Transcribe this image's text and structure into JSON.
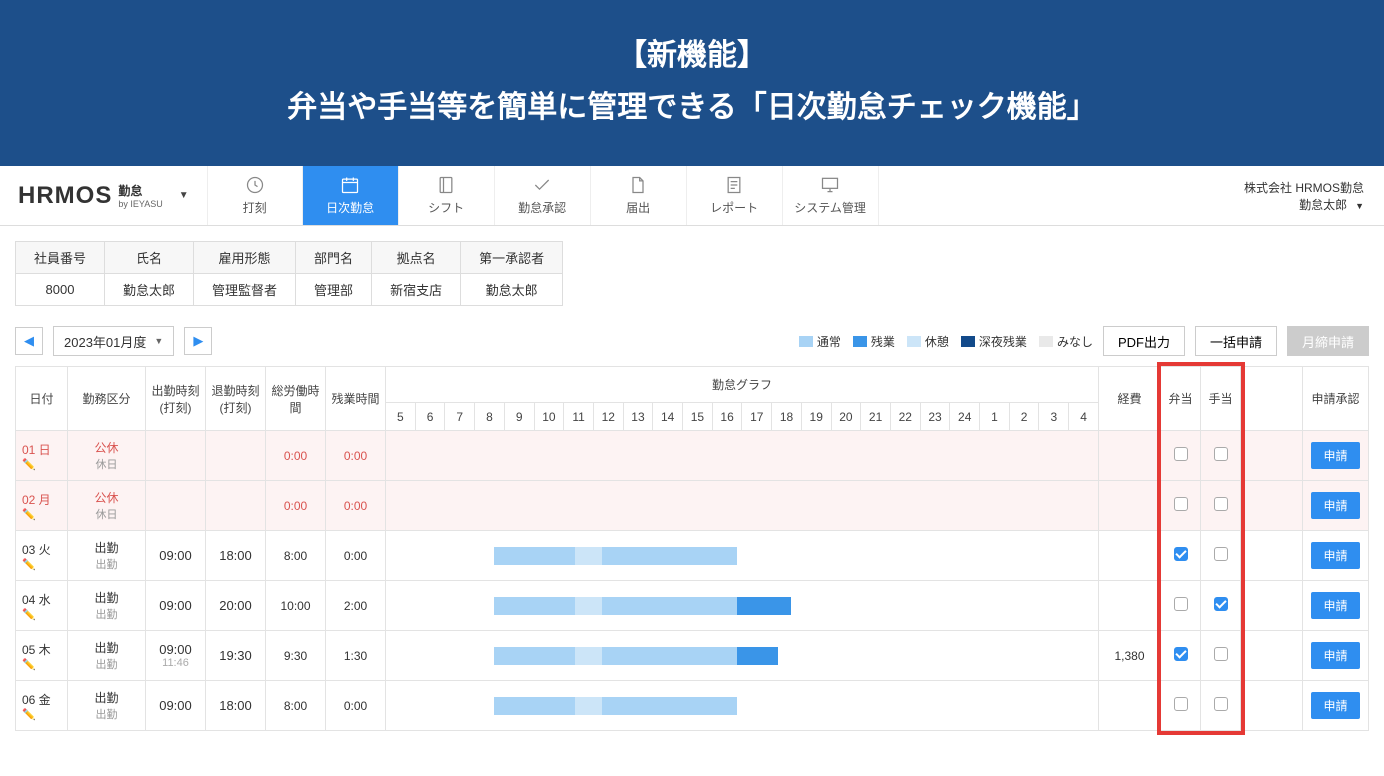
{
  "banner": {
    "line1": "【新機能】",
    "line2": "弁当や手当等を簡単に管理できる「日次勤怠チェック機能」"
  },
  "logo": {
    "main": "HRMOS",
    "sub": "勤怠",
    "tiny": "by IEYASU"
  },
  "nav": [
    {
      "label": "打刻",
      "icon": "clock"
    },
    {
      "label": "日次勤怠",
      "icon": "calendar",
      "active": true
    },
    {
      "label": "シフト",
      "icon": "notebook"
    },
    {
      "label": "勤怠承認",
      "icon": "check"
    },
    {
      "label": "届出",
      "icon": "file"
    },
    {
      "label": "レポート",
      "icon": "doc"
    },
    {
      "label": "システム管理",
      "icon": "monitor"
    }
  ],
  "user": {
    "company": "株式会社 HRMOS勤怠",
    "name": "勤怠太郎"
  },
  "emp": {
    "headers": [
      "社員番号",
      "氏名",
      "雇用形態",
      "部門名",
      "拠点名",
      "第一承認者"
    ],
    "values": [
      "8000",
      "勤怠太郎",
      "管理監督者",
      "管理部",
      "新宿支店",
      "勤怠太郎"
    ]
  },
  "period": "2023年01月度",
  "legend": [
    {
      "label": "通常",
      "cls": "sw-a"
    },
    {
      "label": "残業",
      "cls": "sw-b"
    },
    {
      "label": "休憩",
      "cls": "sw-c"
    },
    {
      "label": "深夜残業",
      "cls": "sw-d"
    },
    {
      "label": "みなし",
      "cls": "sw-e"
    }
  ],
  "actions": {
    "pdf": "PDF出力",
    "batch": "一括申請",
    "month": "月締申請"
  },
  "cols": {
    "date": "日付",
    "kubun": "勤務区分",
    "in": "出勤時刻(打刻)",
    "out": "退勤時刻(打刻)",
    "total": "総労働時間",
    "ot": "残業時間",
    "graph": "勤怠グラフ",
    "keihi": "経費",
    "bento": "弁当",
    "teate": "手当",
    "approve": "申請承認"
  },
  "hours": [
    "5",
    "6",
    "7",
    "8",
    "9",
    "10",
    "11",
    "12",
    "13",
    "14",
    "15",
    "16",
    "17",
    "18",
    "19",
    "20",
    "21",
    "22",
    "23",
    "24",
    "1",
    "2",
    "3",
    "4"
  ],
  "rows": [
    {
      "date": "01",
      "dow": "日",
      "hol": true,
      "kubun": "公休",
      "kubun_sub": "休日",
      "in": "",
      "out": "",
      "total": "0:00",
      "ot": "0:00",
      "keihi": "",
      "bento": false,
      "teate": false,
      "bars": []
    },
    {
      "date": "02",
      "dow": "月",
      "hol": true,
      "kubun": "公休",
      "kubun_sub": "休日",
      "in": "",
      "out": "",
      "total": "0:00",
      "ot": "0:00",
      "keihi": "",
      "bento": false,
      "teate": false,
      "bars": []
    },
    {
      "date": "03",
      "dow": "火",
      "hol": false,
      "kubun": "出勤",
      "kubun_sub": "出勤",
      "in": "09:00",
      "out": "18:00",
      "total": "8:00",
      "ot": "0:00",
      "keihi": "",
      "bento": true,
      "teate": false,
      "bars": [
        {
          "t": "n",
          "s": 9,
          "e": 12
        },
        {
          "t": "b",
          "s": 12,
          "e": 13
        },
        {
          "t": "n",
          "s": 13,
          "e": 18
        }
      ]
    },
    {
      "date": "04",
      "dow": "水",
      "hol": false,
      "kubun": "出勤",
      "kubun_sub": "出勤",
      "in": "09:00",
      "out": "20:00",
      "total": "10:00",
      "ot": "2:00",
      "keihi": "",
      "bento": false,
      "teate": true,
      "bars": [
        {
          "t": "n",
          "s": 9,
          "e": 12
        },
        {
          "t": "b",
          "s": 12,
          "e": 13
        },
        {
          "t": "n",
          "s": 13,
          "e": 18
        },
        {
          "t": "o",
          "s": 18,
          "e": 20
        }
      ]
    },
    {
      "date": "05",
      "dow": "木",
      "hol": false,
      "kubun": "出勤",
      "kubun_sub": "出勤",
      "in": "09:00",
      "in_sub": "11:46",
      "out": "19:30",
      "total": "9:30",
      "ot": "1:30",
      "keihi": "1,380",
      "bento": true,
      "teate": false,
      "bars": [
        {
          "t": "n",
          "s": 9,
          "e": 12
        },
        {
          "t": "b",
          "s": 12,
          "e": 13
        },
        {
          "t": "n",
          "s": 13,
          "e": 18
        },
        {
          "t": "o",
          "s": 18,
          "e": 19.5
        }
      ]
    },
    {
      "date": "06",
      "dow": "金",
      "hol": false,
      "kubun": "出勤",
      "kubun_sub": "出勤",
      "in": "09:00",
      "out": "18:00",
      "total": "8:00",
      "ot": "0:00",
      "keihi": "",
      "bento": false,
      "teate": false,
      "bars": [
        {
          "t": "n",
          "s": 9,
          "e": 12
        },
        {
          "t": "b",
          "s": 12,
          "e": 13
        },
        {
          "t": "n",
          "s": 13,
          "e": 18
        }
      ]
    }
  ],
  "apply_label": "申請"
}
